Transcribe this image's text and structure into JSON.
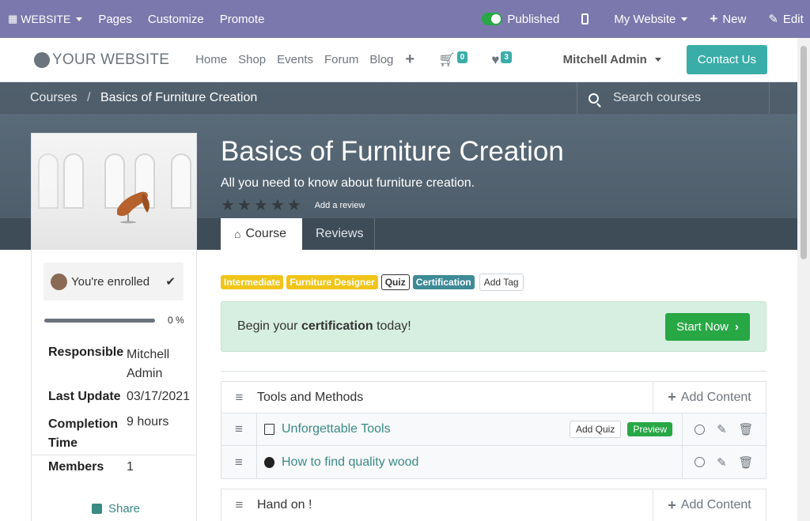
{
  "topbar": {
    "website_label": "WEBSITE",
    "pages": "Pages",
    "customize": "Customize",
    "promote": "Promote",
    "published": "Published",
    "my_website": "My Website",
    "new": "New",
    "edit": "Edit"
  },
  "navbar": {
    "logo": "YOUR WEBSITE",
    "links": [
      "Home",
      "Shop",
      "Events",
      "Forum",
      "Blog"
    ],
    "cart_count": "0",
    "wishlist_count": "3",
    "user": "Mitchell Admin",
    "contact": "Contact Us"
  },
  "breadcrumb": {
    "parent": "Courses",
    "separator": "/",
    "current": "Basics of Furniture Creation"
  },
  "search": {
    "placeholder": "Search courses"
  },
  "course": {
    "title": "Basics of Furniture Creation",
    "subtitle": "All you need to know about furniture creation.",
    "add_review": "Add a review",
    "rating_stars": 0,
    "tabs": [
      "Course",
      "Reviews"
    ]
  },
  "sidebar": {
    "enrolled": "You're enrolled",
    "progress_percent": 0,
    "progress_label": "0 %",
    "info": [
      {
        "key": "Responsible",
        "value": "Mitchell Admin"
      },
      {
        "key": "Last Update",
        "value": "03/17/2021"
      },
      {
        "key": "Completion Time",
        "value": "9 hours"
      },
      {
        "key": "Members",
        "value": "1"
      }
    ],
    "share": "Share"
  },
  "tags": [
    "Intermediate",
    "Furniture Designer",
    "Quiz",
    "Certification"
  ],
  "add_tag": "Add Tag",
  "certification": {
    "text_before": "Begin your ",
    "text_bold": "certification",
    "text_after": " today!",
    "button": "Start Now"
  },
  "sections": [
    {
      "title": "Tools and Methods",
      "add_content": "Add Content",
      "lessons": [
        {
          "title": "Unforgettable Tools",
          "type": "pdf",
          "add_quiz": "Add Quiz",
          "preview": "Preview"
        },
        {
          "title": "How to find quality wood",
          "type": "video"
        }
      ]
    },
    {
      "title": "Hand on !",
      "add_content": "Add Content"
    }
  ],
  "colors": {
    "topbar": "#7b78ad",
    "accent": "#3aada8",
    "success": "#28a745",
    "tag_yellow": "#f0c419",
    "tag_teal": "#3e8a96"
  }
}
